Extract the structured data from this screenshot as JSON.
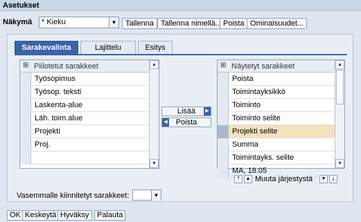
{
  "window": {
    "title": "Asetukset"
  },
  "view": {
    "label": "Näkymä",
    "selected": "* Kieku"
  },
  "toolbar": {
    "save": "Tallenna",
    "save_as": "Tallenna nimellä...",
    "delete": "Poista",
    "properties": "Ominaisuudet..."
  },
  "tabs": [
    "Sarakevalinta",
    "Lajittelu",
    "Esitys"
  ],
  "hidden_columns": {
    "header": "Piilotetut sarakkeet",
    "items": [
      "Työsopimus",
      "Työsop. teksti",
      "Laskenta-alue",
      "Läh. toim.alue",
      "Projekti",
      "Proj."
    ]
  },
  "shown_columns": {
    "header": "Näytetyt sarakkeet",
    "items": [
      "Poista",
      "Toimintayksikkö",
      "Toiminto",
      "Toiminto selite",
      "Projekti selite",
      "Summa",
      "Toimintayks. selite",
      "MA, 18.05"
    ],
    "highlighted_index": 4
  },
  "transfer": {
    "add": "Lisää",
    "remove": "Poista"
  },
  "order": {
    "label": "Muuta järjestystä"
  },
  "pinned": {
    "label": "Vasemmalle kiinnitetyt sarakkeet:"
  },
  "footer": {
    "ok": "OK",
    "cancel": "Keskeytä",
    "accept": "Hyväksy",
    "reset": "Palauta"
  }
}
